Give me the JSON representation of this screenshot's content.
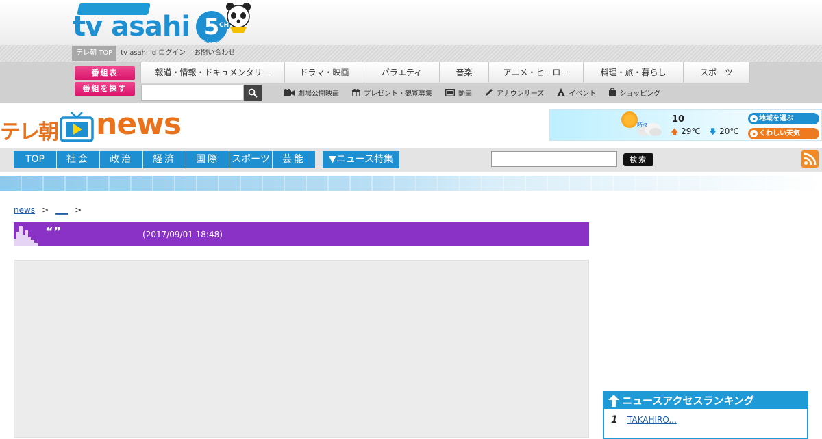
{
  "header": {
    "logo": {
      "text": "tv asahi",
      "channel": "5",
      "ch": "CH",
      "digital": "地デジ"
    },
    "top_links": [
      "テレ朝 TOP",
      "tv asahi id ログイン",
      "お問い合わせ"
    ],
    "program_table_label": "番組表",
    "program_search_label": "番組を探す",
    "categories": [
      "報道・情報・ドキュメンタリー",
      "ドラマ・映画",
      "バラエティ",
      "音楽",
      "アニメ・ヒーロー",
      "料理・旅・暮らし",
      "スポーツ"
    ],
    "sub_links": [
      {
        "label": "劇場公開映画",
        "icon": "film-camera-icon"
      },
      {
        "label": "プレゼント・観覧募集",
        "icon": "gift-icon"
      },
      {
        "label": "動画",
        "icon": "video-icon"
      },
      {
        "label": "アナウンサーズ",
        "icon": "pencil-icon"
      },
      {
        "label": "イベント",
        "icon": "event-icon"
      },
      {
        "label": "ショッピング",
        "icon": "shopping-bag-icon"
      }
    ]
  },
  "news": {
    "logo": {
      "prefix": "テレ朝",
      "word": "news"
    },
    "weather": {
      "condition": "時々",
      "day": "10",
      "high": "29℃",
      "low": "20℃",
      "region_button": "地域を選ぶ",
      "detail_button": "くわしい天気"
    },
    "tabs": [
      "TOP",
      "社会",
      "政治",
      "経済",
      "国際",
      "スポーツ",
      "芸能"
    ],
    "feature_label": "▼ニュース特集",
    "search_button": "検索"
  },
  "article": {
    "breadcrumb": [
      "news",
      "___"
    ],
    "title": "“”",
    "date": "(2017/09/01 18:48)"
  },
  "ranking": {
    "title": "ニュースアクセスランキング",
    "items": [
      {
        "rank": "1",
        "title": "TAKAHIRO..."
      }
    ]
  },
  "colors": {
    "accent": "#1e8fd0",
    "pink": "#e0207a",
    "orange": "#e8731c",
    "purple": "#8a32c6"
  }
}
